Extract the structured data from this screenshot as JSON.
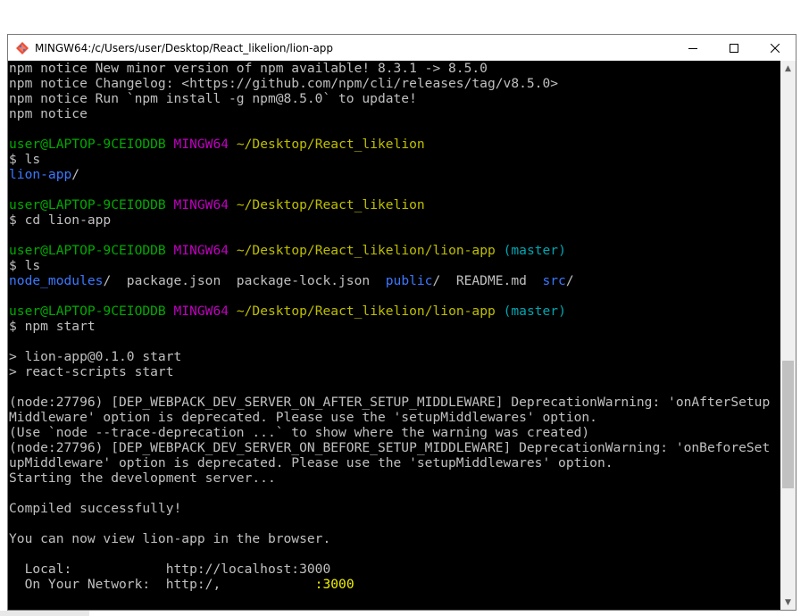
{
  "window": {
    "title": "MINGW64:/c/Users/user/Desktop/React_likelion/lion-app",
    "app_icon": "git-bash-icon",
    "controls": {
      "minimize": "minimize-icon",
      "maximize": "maximize-icon",
      "close": "close-icon"
    }
  },
  "terminal": {
    "colors": {
      "background": "#000000",
      "text": "#c0c0c0",
      "user_host": "#00aa00",
      "mingw": "#bf00bf",
      "path": "#bfbf00",
      "branch": "#00a6b2",
      "directory": "#3b78ff"
    },
    "lines": [
      [
        {
          "t": "npm notice New minor version of npm available! 8.3.1 -> 8.5.0",
          "c": ""
        }
      ],
      [
        {
          "t": "npm notice Changelog: <https://github.com/npm/cli/releases/tag/v8.5.0>",
          "c": ""
        }
      ],
      [
        {
          "t": "npm notice Run `npm install -g npm@8.5.0` to update!",
          "c": ""
        }
      ],
      [
        {
          "t": "npm notice",
          "c": ""
        }
      ],
      [],
      [
        {
          "t": "user@LAPTOP-9CEIODDB",
          "c": "c-green"
        },
        {
          "t": " ",
          "c": ""
        },
        {
          "t": "MINGW64",
          "c": "c-magenta"
        },
        {
          "t": " ",
          "c": ""
        },
        {
          "t": "~/Desktop/React_likelion",
          "c": "c-yellow"
        }
      ],
      [
        {
          "t": "$ ls",
          "c": ""
        }
      ],
      [
        {
          "t": "lion-app",
          "c": "c-blue"
        },
        {
          "t": "/",
          "c": ""
        }
      ],
      [],
      [
        {
          "t": "user@LAPTOP-9CEIODDB",
          "c": "c-green"
        },
        {
          "t": " ",
          "c": ""
        },
        {
          "t": "MINGW64",
          "c": "c-magenta"
        },
        {
          "t": " ",
          "c": ""
        },
        {
          "t": "~/Desktop/React_likelion",
          "c": "c-yellow"
        }
      ],
      [
        {
          "t": "$ cd lion-app",
          "c": ""
        }
      ],
      [],
      [
        {
          "t": "user@LAPTOP-9CEIODDB",
          "c": "c-green"
        },
        {
          "t": " ",
          "c": ""
        },
        {
          "t": "MINGW64",
          "c": "c-magenta"
        },
        {
          "t": " ",
          "c": ""
        },
        {
          "t": "~/Desktop/React_likelion/lion-app",
          "c": "c-yellow"
        },
        {
          "t": " ",
          "c": ""
        },
        {
          "t": "(master)",
          "c": "c-cyan"
        }
      ],
      [
        {
          "t": "$ ls",
          "c": ""
        }
      ],
      [
        {
          "t": "node_modules",
          "c": "c-blue"
        },
        {
          "t": "/  package.json  package-lock.json  ",
          "c": ""
        },
        {
          "t": "public",
          "c": "c-blue"
        },
        {
          "t": "/  README.md  ",
          "c": ""
        },
        {
          "t": "src",
          "c": "c-blue"
        },
        {
          "t": "/",
          "c": ""
        }
      ],
      [],
      [
        {
          "t": "user@LAPTOP-9CEIODDB",
          "c": "c-green"
        },
        {
          "t": " ",
          "c": ""
        },
        {
          "t": "MINGW64",
          "c": "c-magenta"
        },
        {
          "t": " ",
          "c": ""
        },
        {
          "t": "~/Desktop/React_likelion/lion-app",
          "c": "c-yellow"
        },
        {
          "t": " ",
          "c": ""
        },
        {
          "t": "(master)",
          "c": "c-cyan"
        }
      ],
      [
        {
          "t": "$ npm start",
          "c": ""
        }
      ],
      [],
      [
        {
          "t": "> lion-app@0.1.0 start",
          "c": ""
        }
      ],
      [
        {
          "t": "> react-scripts start",
          "c": ""
        }
      ],
      [],
      [
        {
          "t": "(node:27796) [DEP_WEBPACK_DEV_SERVER_ON_AFTER_SETUP_MIDDLEWARE] DeprecationWarning: 'onAfterSetup",
          "c": ""
        }
      ],
      [
        {
          "t": "Middleware' option is deprecated. Please use the 'setupMiddlewares' option.",
          "c": ""
        }
      ],
      [
        {
          "t": "(Use `node --trace-deprecation ...` to show where the warning was created)",
          "c": ""
        }
      ],
      [
        {
          "t": "(node:27796) [DEP_WEBPACK_DEV_SERVER_ON_BEFORE_SETUP_MIDDLEWARE] DeprecationWarning: 'onBeforeSet",
          "c": ""
        }
      ],
      [
        {
          "t": "upMiddleware' option is deprecated. Please use the 'setupMiddlewares' option.",
          "c": ""
        }
      ],
      [
        {
          "t": "Starting the development server...",
          "c": ""
        }
      ],
      [],
      [
        {
          "t": "Compiled successfully!",
          "c": ""
        }
      ],
      [],
      [
        {
          "t": "You can now view lion-app in the browser.",
          "c": ""
        }
      ],
      [],
      [
        {
          "t": "  Local:            http://localhost:",
          "c": ""
        },
        {
          "t": "3000",
          "c": ""
        }
      ],
      [
        {
          "t": "  On Your Network:  http:/,            ",
          "c": ""
        },
        {
          "t": ":3000",
          "c": "c-yellow-bright"
        }
      ]
    ]
  },
  "scrollbar": {
    "up_icon": "scroll-up-arrow-icon",
    "down_icon": "scroll-down-arrow-icon"
  }
}
